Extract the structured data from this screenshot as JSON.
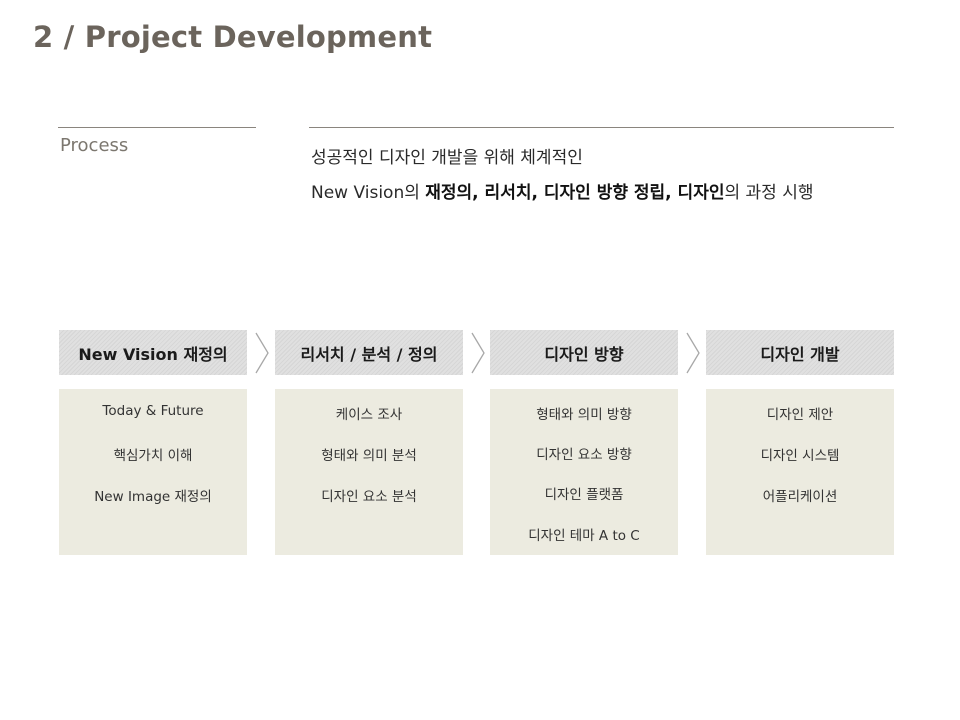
{
  "title": "2 / Project Development",
  "process_label": "Process",
  "description": {
    "line1": "성공적인 디자인 개발을 위해 체계적인",
    "line2_parts": [
      {
        "text": "New Vision의 ",
        "bold": false
      },
      {
        "text": "재정의, 리서치, 디자인 방향 정립, 디자인",
        "bold": true
      },
      {
        "text": "의 과정 시행",
        "bold": false
      }
    ]
  },
  "stages": [
    {
      "header": "New Vision 재정의",
      "items": [
        "Today & Future",
        "핵심가치 이해",
        "New Image 재정의"
      ]
    },
    {
      "header": "리서치 / 분석 / 정의",
      "items": [
        "케이스 조사",
        "형태와 의미 분석",
        "디자인 요소 분석"
      ]
    },
    {
      "header": "디자인 방향",
      "items": [
        "형태와 의미 방향",
        "디자인 요소 방향",
        "디자인 플랫폼",
        "디자인 테마 A to C"
      ]
    },
    {
      "header": "디자인 개발",
      "items": [
        "디자인 제안",
        "디자인 시스템",
        "어플리케이션"
      ]
    }
  ],
  "chevron_icon": "chevron-right-icon"
}
